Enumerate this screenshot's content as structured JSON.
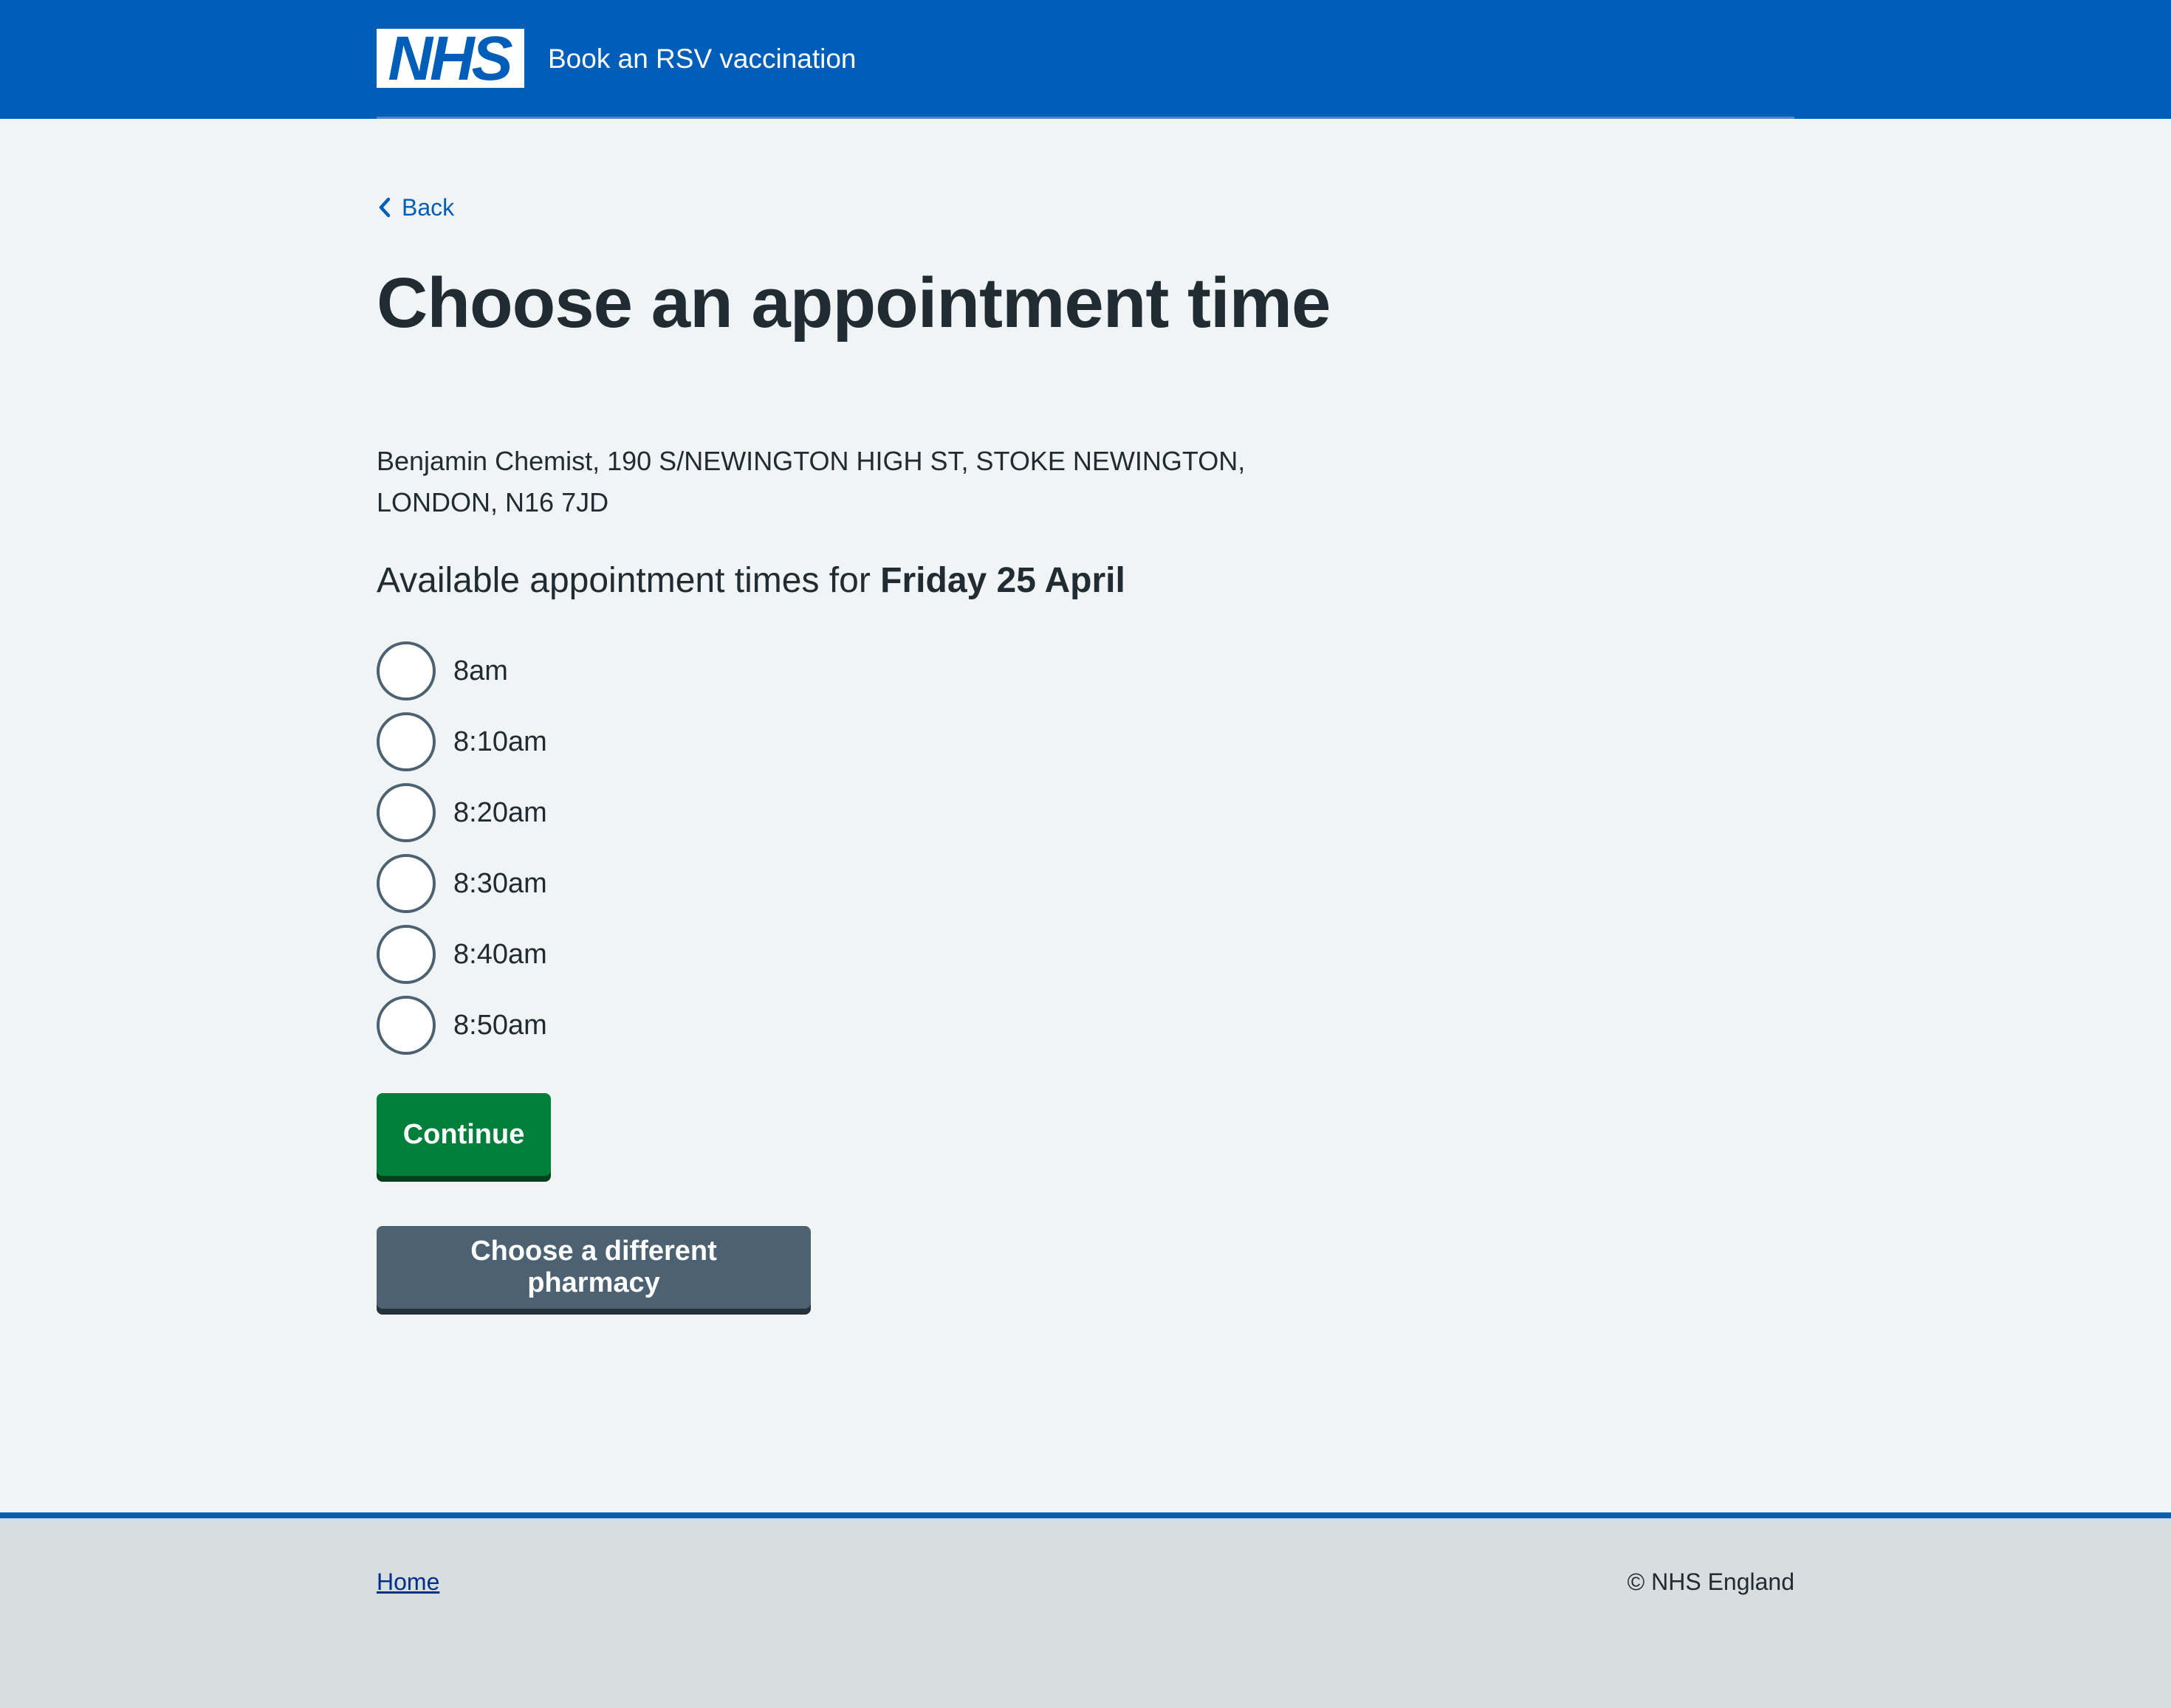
{
  "header": {
    "logo_text": "NHS",
    "service_name": "Book an RSV vaccination",
    "brand_color": "#005eb8"
  },
  "back": {
    "label": "Back",
    "icon": "chevron-left-icon"
  },
  "page": {
    "title": "Choose an appointment time",
    "address": "Benjamin Chemist, 190 S/NEWINGTON HIGH ST, STOKE NEWINGTON, LONDON, N16 7JD",
    "subheading_prefix": "Available appointment times for",
    "subheading_date": "Friday 25 April"
  },
  "times": [
    {
      "label": "8am",
      "selected": false
    },
    {
      "label": "8:10am",
      "selected": false
    },
    {
      "label": "8:20am",
      "selected": false
    },
    {
      "label": "8:30am",
      "selected": false
    },
    {
      "label": "8:40am",
      "selected": false
    },
    {
      "label": "8:50am",
      "selected": false
    }
  ],
  "buttons": {
    "continue_label": "Continue",
    "continue_color": "#007f3b",
    "different_pharmacy_label": "Choose a different pharmacy",
    "different_pharmacy_color": "#4c6272"
  },
  "footer": {
    "home_label": "Home",
    "copyright": "© NHS England"
  }
}
